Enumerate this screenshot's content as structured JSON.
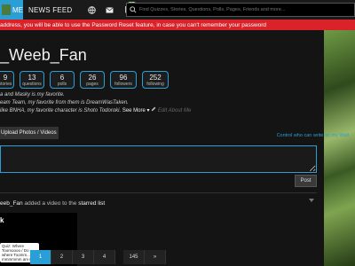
{
  "topbar": {
    "me_label": "ME",
    "newsfeed_label": "NEWS FEED",
    "notification_count": "10",
    "search_placeholder": "Find Quizzes, Stories, Questions, Polls, Pages, Friends and more..."
  },
  "alert": {
    "text": "address, you will be able to use the Password Reset feature, in case you can't remember your password"
  },
  "profile": {
    "username": "_Weeb_Fan",
    "stats": [
      {
        "num": "9",
        "label": "stories"
      },
      {
        "num": "13",
        "label": "questions"
      },
      {
        "num": "6",
        "label": "polls"
      },
      {
        "num": "26",
        "label": "pages"
      },
      {
        "num": "96",
        "label": "followers"
      },
      {
        "num": "252",
        "label": "following"
      }
    ],
    "bio_line1": "a and Masky is my favorite.",
    "bio_line2": "eam Team, my favorite from them is DreamWasTaken.",
    "bio_line3": "like BNHA, my favorite character is Shoto Todoroki.",
    "see_more": "See More ▾",
    "edit_bio": "Edit About Me"
  },
  "actions": {
    "upload_label": "Upload Photos / Videos",
    "control_link": "Control who can write on my Wall",
    "post_label": "Post"
  },
  "activity": {
    "user": "eeb_Fan",
    "text": "added a video to the",
    "link": "starred list",
    "thumb_title": "k",
    "thumb_quiz": "Quiz: Where Toomoooo / Do where Toomm... mmmmmm am I?"
  },
  "pagination": {
    "pages": [
      "1",
      "2",
      "3",
      "4",
      "145",
      "»"
    ]
  }
}
